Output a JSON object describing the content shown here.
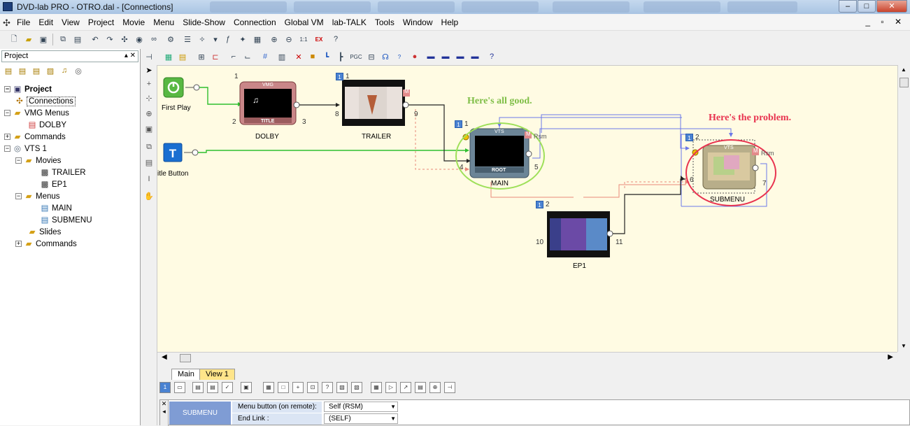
{
  "window": {
    "title": "DVD-lab PRO - OTRO.dal - [Connections]"
  },
  "menu": [
    "File",
    "Edit",
    "View",
    "Project",
    "Movie",
    "Menu",
    "Slide-Show",
    "Connection",
    "Global VM",
    "lab-TALK",
    "Tools",
    "Window",
    "Help"
  ],
  "panel": {
    "title": "Project",
    "tree": [
      {
        "label": "Project",
        "level": 0,
        "icon": "project-icon",
        "exp": "-"
      },
      {
        "label": "Connections",
        "level": 1,
        "icon": "connections-icon",
        "exp": ""
      },
      {
        "label": "VMG Menus",
        "level": 1,
        "icon": "folder-icon",
        "exp": "-"
      },
      {
        "label": "DOLBY",
        "level": 2,
        "icon": "menu-icon",
        "exp": ""
      },
      {
        "label": "Commands",
        "level": 1,
        "icon": "folder-icon",
        "exp": "+"
      },
      {
        "label": "VTS 1",
        "level": 1,
        "icon": "vts-icon",
        "exp": "-"
      },
      {
        "label": "Movies",
        "level": 2,
        "icon": "folder-icon",
        "exp": "-"
      },
      {
        "label": "TRAILER",
        "level": 3,
        "icon": "movie-icon",
        "exp": ""
      },
      {
        "label": "EP1",
        "level": 3,
        "icon": "movie-icon",
        "exp": ""
      },
      {
        "label": "Menus",
        "level": 2,
        "icon": "folder-icon",
        "exp": "-"
      },
      {
        "label": "MAIN",
        "level": 3,
        "icon": "menu-icon",
        "exp": ""
      },
      {
        "label": "SUBMENU",
        "level": 3,
        "icon": "menu-icon",
        "exp": ""
      },
      {
        "label": "Slides",
        "level": 2,
        "icon": "folder-icon",
        "exp": ""
      },
      {
        "label": "Commands",
        "level": 2,
        "icon": "folder-icon",
        "exp": "+"
      }
    ]
  },
  "canvas": {
    "first_play": "First Play",
    "title_button": "itle Button",
    "dolby": {
      "label": "DOLBY",
      "vmg": "VMG",
      "title": "TITLE",
      "num_top": "1",
      "num_left": "2",
      "num_right": "3"
    },
    "trailer": {
      "label": "TRAILER",
      "badge": "1",
      "num_top": "1",
      "num_left": "8",
      "num_right": "9",
      "m": "M"
    },
    "main": {
      "label": "MAIN",
      "vts": "VTS",
      "root": "ROOT",
      "badge": "1",
      "num_top": "1",
      "num_left": "4",
      "num_right": "5",
      "m": "M",
      "rsm": "Rsm"
    },
    "submenu": {
      "label": "SUBMENU",
      "vts": "VTS",
      "badge": "1",
      "num_top": "2",
      "num_left": "6",
      "num_right": "7",
      "m": "M",
      "rsm": "Rsm"
    },
    "ep1": {
      "label": "EP1",
      "badge": "1",
      "num_top": "2",
      "num_left": "10",
      "num_right": "11"
    },
    "annotation_good": "Here's all good.",
    "annotation_bad": "Here's the problem."
  },
  "tabs": [
    "Main",
    "View 1"
  ],
  "properties": {
    "object": "SUBMENU",
    "rows": [
      {
        "key": "Menu button (on remote):",
        "value": "Self (RSM)"
      },
      {
        "key": "End Link :",
        "value": "(SELF)"
      }
    ]
  }
}
